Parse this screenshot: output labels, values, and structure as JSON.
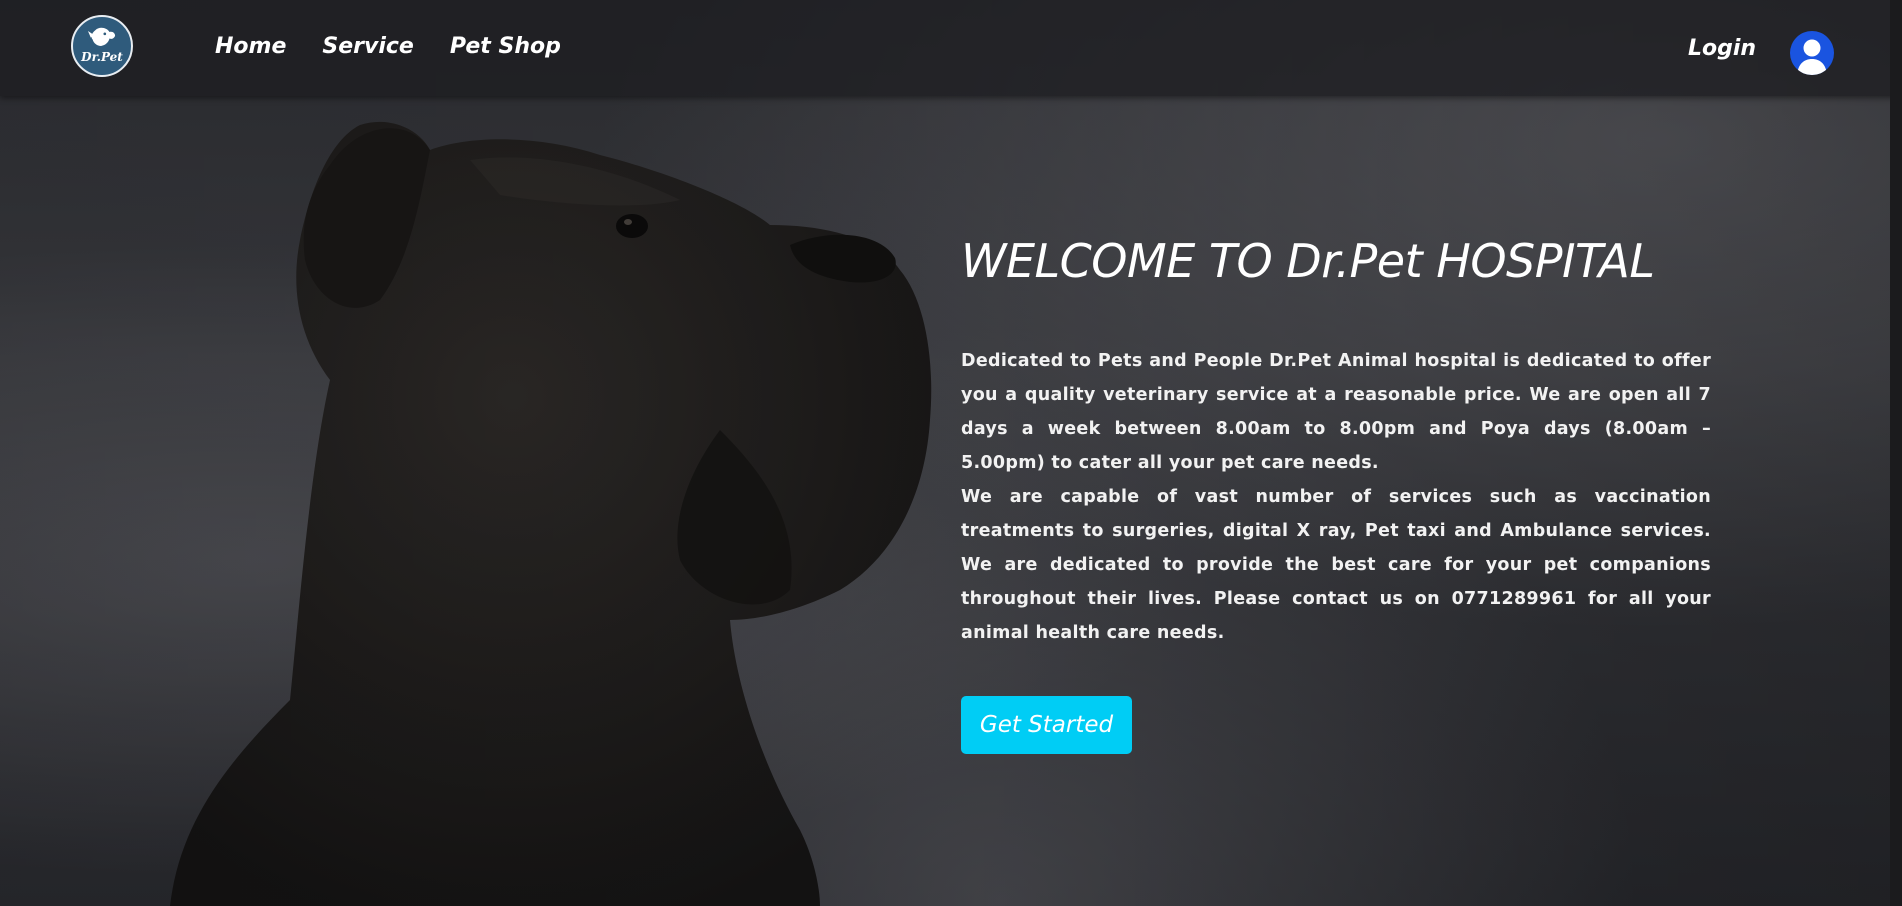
{
  "brand": {
    "logo_text": "Dr.Pet"
  },
  "nav": {
    "items": [
      {
        "label": "Home"
      },
      {
        "label": "Service"
      },
      {
        "label": "Pet Shop"
      }
    ],
    "login_label": "Login"
  },
  "hero": {
    "headline": "WELCOME TO Dr.Pet HOSPITAL",
    "paragraph_1": "Dedicated to Pets and People Dr.Pet Animal hospital is dedicated to offer you a quality veterinary service at a reasonable price. We are open all 7 days a week between 8.00am to 8.00pm and Poya days (8.00am – 5.00pm) to cater all your pet care needs.",
    "paragraph_2": "We are capable of vast number of services such as vaccination treatments to surgeries, digital X ray, Pet taxi and Ambulance services. We are dedicated to provide the best care for your pet companions throughout their lives. Please contact us on 0771289961 for all your animal health care needs.",
    "cta_label": "Get Started"
  },
  "colors": {
    "accent": "#00cdf5",
    "avatar_bg": "#1a54e0",
    "logo_bg": "#2f5b7c",
    "navbar_bg": "#1e1e21"
  },
  "icons": {
    "logo": "dog-cat-logo-icon",
    "avatar": "user-avatar-icon"
  }
}
